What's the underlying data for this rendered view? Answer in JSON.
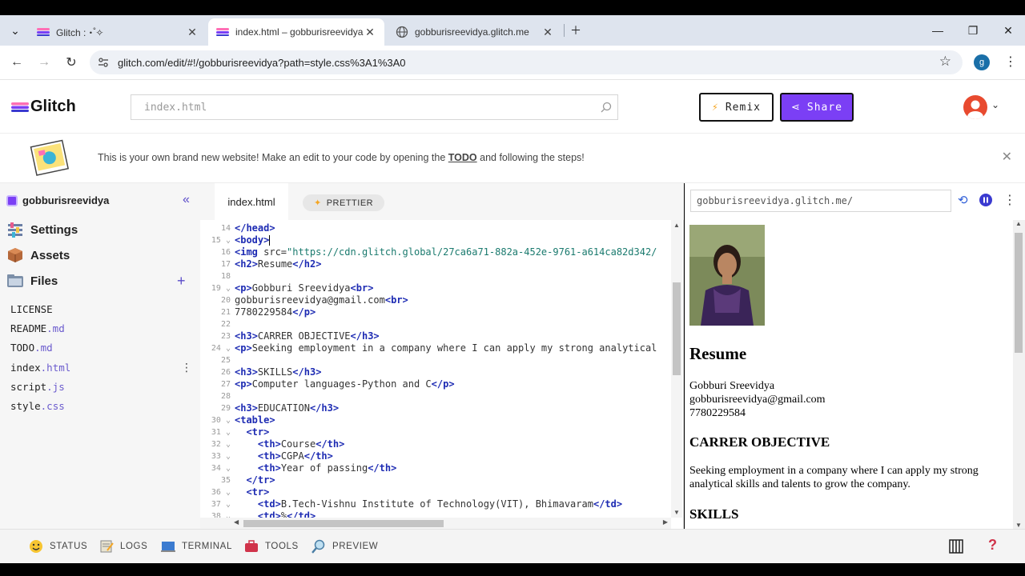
{
  "browser": {
    "tabs": [
      {
        "title": "Glitch :・゚✧",
        "active": false
      },
      {
        "title": "index.html – gobburisreevidya",
        "active": true
      },
      {
        "title": "gobburisreevidya.glitch.me",
        "active": false
      }
    ],
    "url": "glitch.com/edit/#!/gobburisreevidya?path=style.css%3A1%3A0",
    "profile_initial": "g"
  },
  "header": {
    "logo": "Glitch",
    "search_placeholder": "index.html",
    "remix_label": "Remix",
    "share_label": "Share"
  },
  "banner": {
    "text_before": "This is your own brand new website! Make an edit to your code by opening the ",
    "todo_link": "TODO",
    "text_after": " and following the steps!"
  },
  "sidebar": {
    "project_name": "gobburisreevidya",
    "nav": [
      {
        "label": "Settings",
        "icon": "settings-icon"
      },
      {
        "label": "Assets",
        "icon": "assets-icon"
      },
      {
        "label": "Files",
        "icon": "files-icon"
      }
    ],
    "files": [
      {
        "name": "LICENSE",
        "ext": ""
      },
      {
        "name": "README",
        "ext": ".md"
      },
      {
        "name": "TODO",
        "ext": ".md"
      },
      {
        "name": "index",
        "ext": ".html",
        "selected": true
      },
      {
        "name": "script",
        "ext": ".js"
      },
      {
        "name": "style",
        "ext": ".css"
      }
    ]
  },
  "editor": {
    "tab_label": "index.html",
    "prettier_label": "PRETTIER",
    "lines": [
      {
        "n": "14",
        "fold": false,
        "code": "</head>"
      },
      {
        "n": "15",
        "fold": true,
        "code": "<body>"
      },
      {
        "n": "16",
        "fold": false,
        "code": "<img src=\"https://cdn.glitch.global/27ca6a71-882a-452e-9761-a614ca82d342/"
      },
      {
        "n": "17",
        "fold": false,
        "code": "<h2>Resume</h2>"
      },
      {
        "n": "18",
        "fold": false,
        "code": ""
      },
      {
        "n": "19",
        "fold": true,
        "code": "<p>Gobburi Sreevidya<br>"
      },
      {
        "n": "20",
        "fold": false,
        "code": "gobburisreevidya@gmail.com<br>"
      },
      {
        "n": "21",
        "fold": false,
        "code": "7780229584</p>"
      },
      {
        "n": "22",
        "fold": false,
        "code": ""
      },
      {
        "n": "23",
        "fold": false,
        "code": "<h3>CARRER OBJECTIVE</h3>"
      },
      {
        "n": "24",
        "fold": true,
        "code": "<p>Seeking employment in a company where I can apply my strong analytical"
      },
      {
        "n": "25",
        "fold": false,
        "code": ""
      },
      {
        "n": "26",
        "fold": false,
        "code": "<h3>SKILLS</h3>"
      },
      {
        "n": "27",
        "fold": false,
        "code": "<p>Computer languages-Python and C</p>"
      },
      {
        "n": "28",
        "fold": false,
        "code": ""
      },
      {
        "n": "29",
        "fold": false,
        "code": "<h3>EDUCATION</h3>"
      },
      {
        "n": "30",
        "fold": true,
        "code": "<table>"
      },
      {
        "n": "31",
        "fold": true,
        "code": "  <tr>"
      },
      {
        "n": "32",
        "fold": true,
        "code": "    <th>Course</th>"
      },
      {
        "n": "33",
        "fold": true,
        "code": "    <th>CGPA</th>"
      },
      {
        "n": "34",
        "fold": true,
        "code": "    <th>Year of passing</th>"
      },
      {
        "n": "35",
        "fold": false,
        "code": "  </tr>"
      },
      {
        "n": "36",
        "fold": true,
        "code": "  <tr>"
      },
      {
        "n": "37",
        "fold": true,
        "code": "    <td>B.Tech-Vishnu Institute of Technology(VIT), Bhimavaram</td>"
      },
      {
        "n": "38",
        "fold": true,
        "code": "    <td>%</td>"
      }
    ]
  },
  "preview": {
    "url": "gobburisreevidya.glitch.me/",
    "heading": "Resume",
    "name": "Gobburi Sreevidya",
    "email": "gobburisreevidya@gmail.com",
    "phone": "7780229584",
    "objective_heading": "CARRER OBJECTIVE",
    "objective_text_1": "Seeking employment in a company where I can apply my strong",
    "objective_text_2": "analytical skills and talents to grow the company.",
    "skills_heading": "SKILLS"
  },
  "footer": {
    "items": [
      {
        "label": "STATUS",
        "icon": "status-smiley-icon"
      },
      {
        "label": "LOGS",
        "icon": "logs-icon"
      },
      {
        "label": "TERMINAL",
        "icon": "terminal-icon"
      },
      {
        "label": "TOOLS",
        "icon": "tools-icon"
      },
      {
        "label": "PREVIEW",
        "icon": "preview-icon"
      }
    ],
    "help": "?"
  },
  "colors": {
    "accent": "#7b3ff5",
    "tag": "#1d2bb3",
    "string": "#1a7a6e"
  }
}
